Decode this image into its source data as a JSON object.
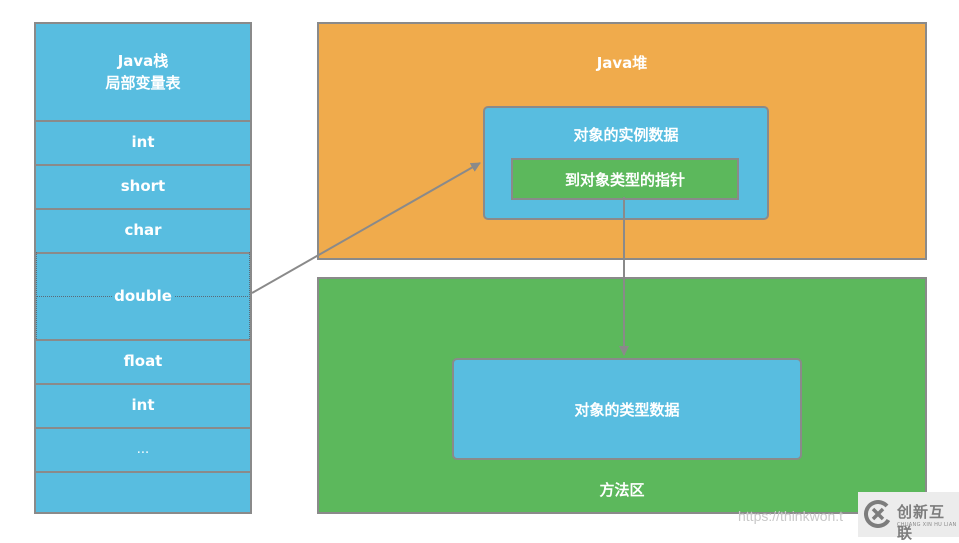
{
  "stack": {
    "header_line1": "Java栈",
    "header_line2": "局部变量表",
    "cells": [
      "int",
      "short",
      "char",
      "double",
      "float",
      "int",
      "...",
      ""
    ]
  },
  "heap": {
    "title": "Java堆",
    "instance_title": "对象的实例数据",
    "pointer_label": "到对象类型的指针"
  },
  "method_area": {
    "title": "方法区",
    "type_data_label": "对象的类型数据"
  },
  "colors": {
    "stack_blue": "#58bde0",
    "heap_orange": "#f0ab4c",
    "method_green": "#5cb85c",
    "border_gray": "#8a8a8a"
  },
  "watermark": {
    "url_text": "https://thinkwon.t",
    "logo_name": "创新互联",
    "logo_sub": "CHUANG XIN HU LIAN"
  }
}
